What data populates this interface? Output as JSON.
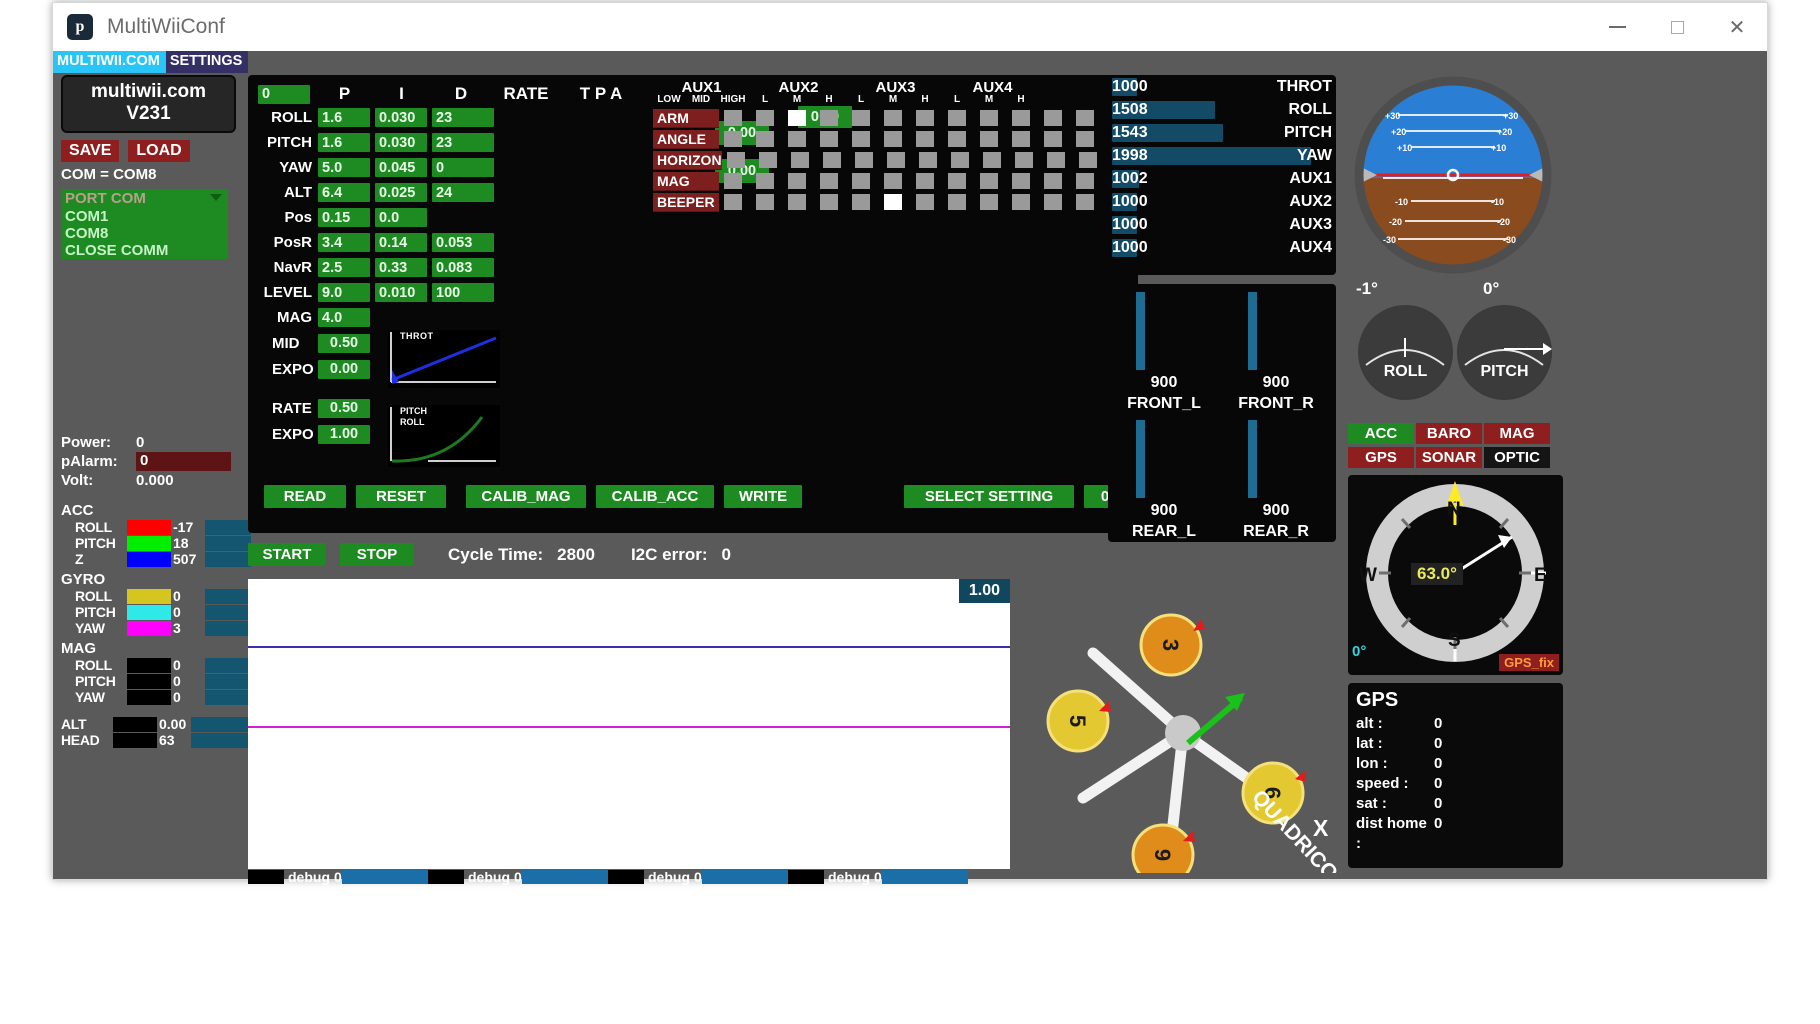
{
  "window": {
    "title": "MultiWiiConf",
    "icon": "processing-app-icon",
    "minimize": "minimize-icon",
    "maximize": "maximize-icon",
    "close": "close-icon"
  },
  "menubar": {
    "items": [
      "MULTIWII.COM",
      "SETTINGS"
    ]
  },
  "left": {
    "version_line1": "multiwii.com",
    "version_line2": "V231",
    "save": "SAVE",
    "load": "LOAD",
    "com_label": "COM = COM8",
    "port_combo": {
      "selected": "PORT COM",
      "options": [
        "COM1",
        "COM8",
        "CLOSE COMM"
      ]
    },
    "power": {
      "power_label": "Power:",
      "power_value": "0",
      "palarm_label": "pAlarm:",
      "palarm_value": "0",
      "volt_label": "Volt:",
      "volt_value": "0.000"
    },
    "sensors": [
      {
        "group": "ACC",
        "rows": [
          {
            "name": "ROLL",
            "color": "#ff0000",
            "value": "-17",
            "bar": 55
          },
          {
            "name": "PITCH",
            "color": "#00ee00",
            "value": "18",
            "bar": 40
          },
          {
            "name": "Z",
            "color": "#0000ff",
            "value": "507",
            "bar": 78
          }
        ]
      },
      {
        "group": "GYRO",
        "rows": [
          {
            "name": "ROLL",
            "color": "#d4c520",
            "value": "0",
            "bar": 45
          },
          {
            "name": "PITCH",
            "color": "#2fe8e8",
            "value": "0",
            "bar": 45
          },
          {
            "name": "YAW",
            "color": "#ff00ff",
            "value": "3",
            "bar": 45
          }
        ]
      },
      {
        "group": "MAG",
        "rows": [
          {
            "name": "ROLL",
            "color": "#000000",
            "value": "0",
            "bar": 45
          },
          {
            "name": "PITCH",
            "color": "#000000",
            "value": "0",
            "bar": 45
          },
          {
            "name": "YAW",
            "color": "#000000",
            "value": "0",
            "bar": 45
          }
        ]
      }
    ],
    "alt": {
      "name": "ALT",
      "value": "0.00"
    },
    "head": {
      "name": "HEAD",
      "value": "63"
    }
  },
  "pid": {
    "profile_index": "0",
    "headers": [
      "P",
      "I",
      "D",
      "RATE",
      "T P A"
    ],
    "rows": [
      {
        "name": "ROLL",
        "p": "1.6",
        "i": "0.030",
        "d": "23"
      },
      {
        "name": "PITCH",
        "p": "1.6",
        "i": "0.030",
        "d": "23"
      },
      {
        "name": "YAW",
        "p": "5.0",
        "i": "0.045",
        "d": "0"
      },
      {
        "name": "ALT",
        "p": "6.4",
        "i": "0.025",
        "d": "24"
      },
      {
        "name": "Pos",
        "p": "0.15",
        "i": "0.0",
        "d": ""
      },
      {
        "name": "PosR",
        "p": "3.4",
        "i": "0.14",
        "d": "0.053"
      },
      {
        "name": "NavR",
        "p": "2.5",
        "i": "0.33",
        "d": "0.083"
      },
      {
        "name": "LEVEL",
        "p": "9.0",
        "i": "0.010",
        "d": "100"
      },
      {
        "name": "MAG",
        "p": "4.0",
        "i": "",
        "d": ""
      }
    ],
    "rate_roll_pitch": "0.00",
    "rate_yaw": "0.00",
    "tpa": "0.00",
    "throt_mid_label": "MID",
    "throt_mid": "0.50",
    "throt_expo_label": "EXPO",
    "throt_expo": "0.00",
    "rc_rate_label": "RATE",
    "rc_rate": "0.50",
    "rc_expo_label": "EXPO",
    "rc_expo": "1.00",
    "graph_throt_label": "THROT",
    "graph_pitchroll_label1": "PITCH",
    "graph_pitchroll_label2": "ROLL"
  },
  "actions": {
    "read": "READ",
    "reset": "RESET",
    "calib_mag": "CALIB_MAG",
    "calib_acc": "CALIB_ACC",
    "write": "WRITE",
    "select_setting": "SELECT SETTING",
    "setting_index": "0"
  },
  "aux": {
    "groups": [
      "AUX1",
      "AUX2",
      "AUX3",
      "AUX4"
    ],
    "sub_first": [
      "LOW",
      "MID",
      "HIGH"
    ],
    "sub_rest": [
      "L",
      "M",
      "H"
    ],
    "rows": [
      {
        "name": "ARM",
        "checks": [
          0,
          0,
          1,
          0,
          0,
          0,
          0,
          0,
          0,
          0,
          0,
          0
        ]
      },
      {
        "name": "ANGLE",
        "checks": [
          0,
          0,
          0,
          0,
          0,
          0,
          0,
          0,
          0,
          0,
          0,
          0
        ]
      },
      {
        "name": "HORIZON",
        "checks": [
          0,
          0,
          0,
          0,
          0,
          0,
          0,
          0,
          0,
          0,
          0,
          0
        ]
      },
      {
        "name": "MAG",
        "checks": [
          0,
          0,
          0,
          0,
          0,
          0,
          0,
          0,
          0,
          0,
          0,
          0
        ]
      },
      {
        "name": "BEEPER",
        "checks": [
          0,
          0,
          0,
          0,
          0,
          1,
          0,
          0,
          0,
          0,
          0,
          0
        ]
      }
    ]
  },
  "control": {
    "start": "START",
    "stop": "STOP",
    "cycle_label": "Cycle Time:",
    "cycle_value": "2800",
    "i2c_label": "I2C error:",
    "i2c_value": "0"
  },
  "plot": {
    "scale_tag": "1.00",
    "debug": [
      {
        "label": "debug",
        "value": "0"
      },
      {
        "label": "debug",
        "value": "0"
      },
      {
        "label": "debug",
        "value": "0"
      },
      {
        "label": "debug",
        "value": "0"
      }
    ]
  },
  "rc_channels": [
    {
      "name": "THROT",
      "value": "1000",
      "pct": 12
    },
    {
      "name": "ROLL",
      "value": "1508",
      "pct": 50
    },
    {
      "name": "PITCH",
      "value": "1543",
      "pct": 54
    },
    {
      "name": "YAW",
      "value": "1998",
      "pct": 97
    },
    {
      "name": "AUX1",
      "value": "1002",
      "pct": 13
    },
    {
      "name": "AUX2",
      "value": "1000",
      "pct": 12
    },
    {
      "name": "AUX3",
      "value": "1000",
      "pct": 12
    },
    {
      "name": "AUX4",
      "value": "1000",
      "pct": 12
    }
  ],
  "motors": [
    {
      "name": "FRONT_L",
      "value": "900",
      "pct": 62
    },
    {
      "name": "FRONT_R",
      "value": "900",
      "pct": 62
    },
    {
      "name": "REAR_L",
      "value": "900",
      "pct": 62
    },
    {
      "name": "REAR_R",
      "value": "900",
      "pct": 62
    }
  ],
  "attitude": {
    "ladder_labels_left": [
      "+30",
      "+20",
      "+10",
      "-10",
      "-20",
      "-30"
    ],
    "ladder_labels_right": [
      "+30",
      "+20",
      "+10",
      "-10",
      "-20",
      "-30"
    ],
    "roll_value": "-1°",
    "pitch_value": "0°",
    "roll_dial_label": "ROLL",
    "pitch_dial_label": "PITCH"
  },
  "status_badges": [
    {
      "name": "ACC",
      "state": "ok"
    },
    {
      "name": "BARO",
      "state": "off"
    },
    {
      "name": "MAG",
      "state": "off"
    },
    {
      "name": "GPS",
      "state": "off"
    },
    {
      "name": "SONAR",
      "state": "off"
    },
    {
      "name": "OPTIC",
      "state": "dk"
    }
  ],
  "compass": {
    "n": "N",
    "e": "E",
    "s": "S",
    "w": "W",
    "heading": "63.0°",
    "left_angle": "0°",
    "gps_fix": "GPS_fix"
  },
  "gps": {
    "title": "GPS",
    "rows": [
      {
        "k": "alt :",
        "v": "0"
      },
      {
        "k": "lat :",
        "v": "0"
      },
      {
        "k": "lon :",
        "v": "0"
      },
      {
        "k": "speed :",
        "v": "0"
      },
      {
        "k": "sat :",
        "v": "0"
      },
      {
        "k": "dist home :",
        "v": "0"
      }
    ]
  },
  "model": {
    "label": "QUADRICOPTER",
    "axis": "X",
    "motor_ids": [
      "3",
      "5",
      "6",
      "9"
    ]
  }
}
